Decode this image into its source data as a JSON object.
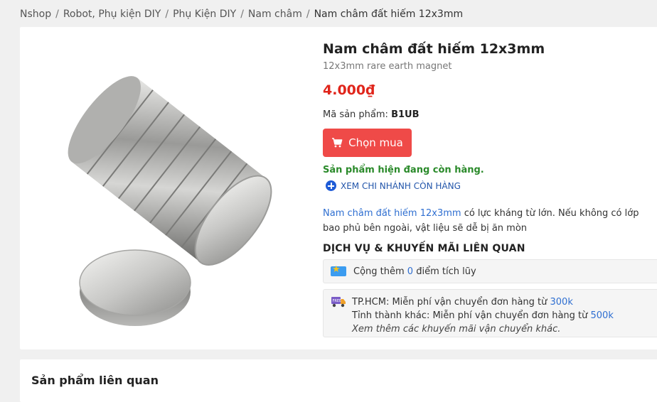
{
  "breadcrumb": {
    "items": [
      "Nshop",
      "Robot, Phụ kiện DIY",
      "Phụ Kiện DIY",
      "Nam châm"
    ],
    "current": "Nam châm đất hiếm 12x3mm",
    "separator": "/"
  },
  "product": {
    "title": "Nam châm đất hiếm 12x3mm",
    "subtitle": "12x3mm rare earth magnet",
    "price": "4.000₫",
    "sku_label": "Mã sản phẩm:",
    "sku": "B1UB",
    "buy_label": "Chọn mua",
    "stock_status": "Sản phẩm hiện đang còn hàng.",
    "branches_link": "XEM CHI NHÁNH CÒN HÀNG",
    "description_link": "Nam châm đất hiếm 12x3mm",
    "description_rest": " có lực kháng từ lớn. Nếu không có lớp bao phủ bên ngoài, vật liệu sẽ dễ bị ăn mòn"
  },
  "services": {
    "heading": "DỊCH VỤ & KHUYẾN MÃI LIÊN QUAN",
    "points_prefix": "Cộng thêm ",
    "points_value": "0",
    "points_suffix": " điểm tích lũy",
    "shipping": {
      "hcm_prefix": "TP.HCM: Miễn phí vận chuyển đơn hàng từ ",
      "hcm_value": "300k",
      "province_prefix": "Tỉnh thành khác: Miễn phí vận chuyển đơn hàng từ ",
      "province_value": "500k",
      "more": "Xem thêm các khuyến mãi vận chuyển khác."
    }
  },
  "related": {
    "heading": "Sản phẩm liên quan"
  },
  "colors": {
    "accent": "#ef4a48",
    "price": "#e0251b",
    "stock": "#2a8a2a",
    "link": "#2f6fd1"
  },
  "icons": {
    "cart": "cart-icon",
    "plus": "plus-circle-icon",
    "points": "star-badge-icon",
    "shipping": "free-shipping-truck-icon"
  }
}
